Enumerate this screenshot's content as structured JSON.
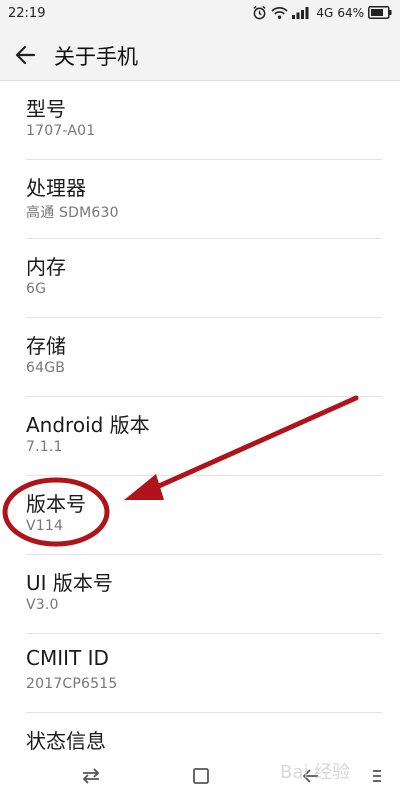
{
  "status_bar": {
    "time": "22:19",
    "network": "4G",
    "battery": "64%",
    "icons": [
      "alarm-icon",
      "wifi-icon",
      "signal-icon",
      "battery-icon"
    ]
  },
  "app_bar": {
    "title": "关于手机",
    "back_icon": "arrow-left-icon"
  },
  "items": [
    {
      "title": "型号",
      "value": "1707-A01"
    },
    {
      "title": "处理器",
      "value": "高通 SDM630"
    },
    {
      "title": "内存",
      "value": "6G"
    },
    {
      "title": "存储",
      "value": "64GB"
    },
    {
      "title": "Android 版本",
      "value": "7.1.1"
    },
    {
      "title": "版本号",
      "value": "V114"
    },
    {
      "title": "UI 版本号",
      "value": "V3.0"
    },
    {
      "title": "CMIIT ID",
      "value": "2017CP6515"
    },
    {
      "title": "状态信息",
      "value": ""
    }
  ],
  "annotation": {
    "color": "#b0141a",
    "highlighted_item": "版本号"
  },
  "nav_bar": {
    "icons": [
      "recent-apps-icon",
      "home-icon",
      "back-icon",
      "menu-icon"
    ]
  },
  "watermark": "Bai 经验"
}
